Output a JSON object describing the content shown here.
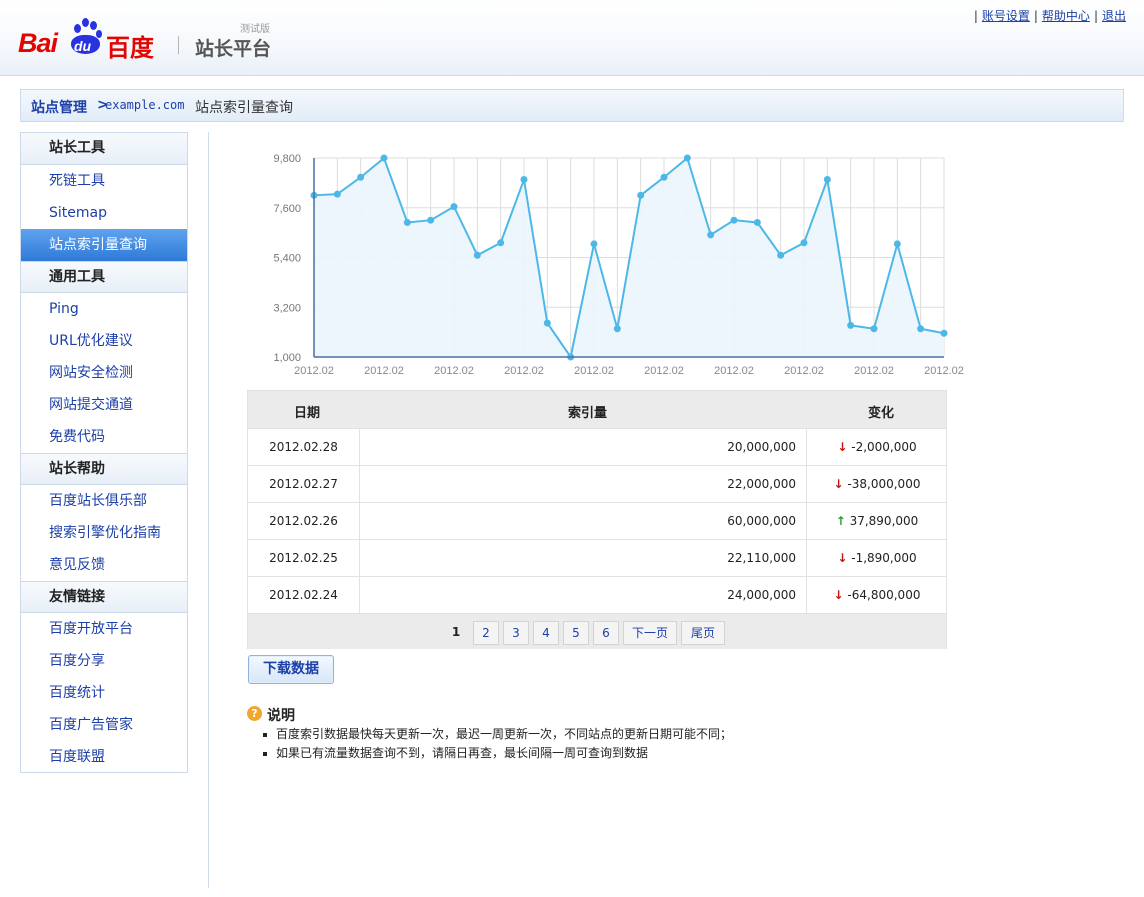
{
  "header": {
    "logo_bai": "Bai",
    "logo_du": "du",
    "logo_cn": "百度",
    "logo_sub": "站长平台",
    "logo_beta": "测试版",
    "links": [
      "账号设置",
      "帮助中心",
      "退出"
    ],
    "separator": "|"
  },
  "breadcrumb": {
    "root": "站点管理",
    "arrow": ">",
    "site": "example.com",
    "current": "站点索引量查询"
  },
  "sidebar": {
    "groups": [
      {
        "title": "站长工具",
        "items": [
          "死链工具",
          "Sitemap",
          "站点索引量查询"
        ]
      },
      {
        "title": "通用工具",
        "items": [
          "Ping",
          "URL优化建议",
          "网站安全检测",
          "网站提交通道",
          "免费代码"
        ]
      },
      {
        "title": "站长帮助",
        "items": [
          "百度站长俱乐部",
          "搜索引擎优化指南",
          "意见反馈"
        ]
      },
      {
        "title": "友情链接",
        "items": [
          "百度开放平台",
          "百度分享",
          "百度统计",
          "百度广告管家",
          "百度联盟"
        ]
      }
    ],
    "active_item": "站点索引量查询"
  },
  "chart_data": {
    "type": "area",
    "x_tick_labels": [
      "2012.02",
      "2012.02",
      "2012.02",
      "2012.02",
      "2012.02",
      "2012.02",
      "2012.02",
      "2012.02",
      "2012.02",
      "2012.02"
    ],
    "y_tick_labels": [
      "1,000",
      "3,200",
      "5,400",
      "7,600",
      "9,800"
    ],
    "ylim": [
      1000,
      9800
    ],
    "values": [
      8150,
      8200,
      8950,
      9800,
      6950,
      7050,
      7650,
      5500,
      6050,
      8850,
      2500,
      1000,
      6000,
      2250,
      8150,
      8950,
      9800,
      6400,
      7050,
      6950,
      5500,
      6050,
      8850,
      2400,
      2250,
      6000,
      2250,
      2050
    ],
    "grid": true,
    "colors": {
      "line": "#4db8e8",
      "fill": "#eaf5fc",
      "marker": "#4db8e8",
      "grid": "#dddddd",
      "axis": "#4a6fa5"
    }
  },
  "table": {
    "headers": [
      "日期",
      "索引量",
      "变化"
    ],
    "rows": [
      {
        "date": "2012.02.28",
        "count": "20,000,000",
        "dir": "down",
        "change": "-2,000,000"
      },
      {
        "date": "2012.02.27",
        "count": "22,000,000",
        "dir": "down",
        "change": "-38,000,000"
      },
      {
        "date": "2012.02.26",
        "count": "60,000,000",
        "dir": "up",
        "change": "37,890,000"
      },
      {
        "date": "2012.02.25",
        "count": "22,110,000",
        "dir": "down",
        "change": "-1,890,000"
      },
      {
        "date": "2012.02.24",
        "count": "24,000,000",
        "dir": "down",
        "change": "-64,800,000"
      }
    ],
    "arrows": {
      "down": "↓",
      "up": "↑"
    }
  },
  "pager": {
    "current": "1",
    "pages": [
      "2",
      "3",
      "4",
      "5",
      "6"
    ],
    "next": "下一页",
    "last": "尾页"
  },
  "download_button": "下载数据",
  "note": {
    "icon": "?",
    "title": "说明",
    "items": [
      "百度索引数据最快每天更新一次，最迟一周更新一次，不同站点的更新日期可能不同；",
      "如果已有流量数据查询不到，请隔日再查，最长间隔一周可查询到数据"
    ]
  }
}
